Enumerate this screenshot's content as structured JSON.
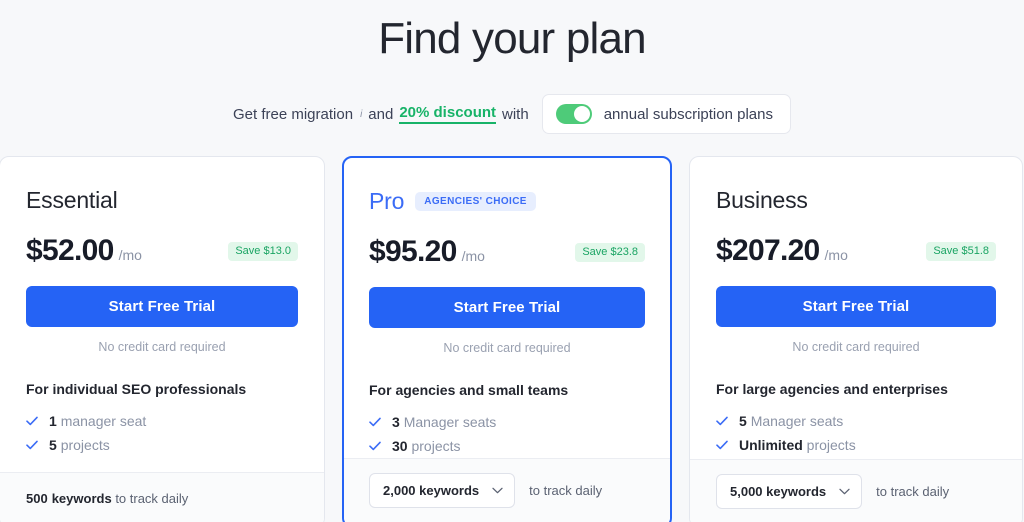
{
  "header": {
    "title": "Find your plan",
    "promo_prefix": "Get free migration",
    "promo_sup": "i",
    "promo_and": "and",
    "promo_discount": "20% discount",
    "promo_with": "with",
    "toggle_label": "annual subscription plans",
    "toggle_on": true,
    "accent_green": "#18b368",
    "toggle_green": "#4ecb79"
  },
  "plans": [
    {
      "name": "Essential",
      "badge": null,
      "price": "$52.00",
      "period": "/mo",
      "save": "Save $13.0",
      "cta": "Start Free Trial",
      "cta_note": "No credit card required",
      "feature_title": "For individual SEO professionals",
      "features": [
        {
          "value": "1",
          "label": "manager seat"
        },
        {
          "value": "5",
          "label": "projects"
        }
      ],
      "keywords_mode": "static",
      "keywords_value": "500",
      "keywords_word": "keywords",
      "keywords_suffix": "to track daily"
    },
    {
      "name": "Pro",
      "badge": "AGENCIES' CHOICE",
      "price": "$95.20",
      "period": "/mo",
      "save": "Save $23.8",
      "cta": "Start Free Trial",
      "cta_note": "No credit card required",
      "feature_title": "For agencies and small teams",
      "features": [
        {
          "value": "3",
          "label": "Manager seats"
        },
        {
          "value": "30",
          "label": "projects"
        }
      ],
      "keywords_mode": "select",
      "keywords_value": "2,000 keywords",
      "keywords_suffix": "to track daily"
    },
    {
      "name": "Business",
      "badge": null,
      "price": "$207.20",
      "period": "/mo",
      "save": "Save $51.8",
      "cta": "Start Free Trial",
      "cta_note": "No credit card required",
      "feature_title": "For large agencies and enterprises",
      "features": [
        {
          "value": "5",
          "label": "Manager seats"
        },
        {
          "value": "Unlimited",
          "label": "projects"
        }
      ],
      "keywords_mode": "select",
      "keywords_value": "5,000 keywords",
      "keywords_suffix": "to track daily"
    }
  ],
  "colors": {
    "primary_blue": "#2563f5",
    "badge_blue_bg": "#e7eefe",
    "save_green_bg": "#e2f7ea",
    "save_green_text": "#1aa463",
    "page_bg": "#f7f8fa"
  }
}
